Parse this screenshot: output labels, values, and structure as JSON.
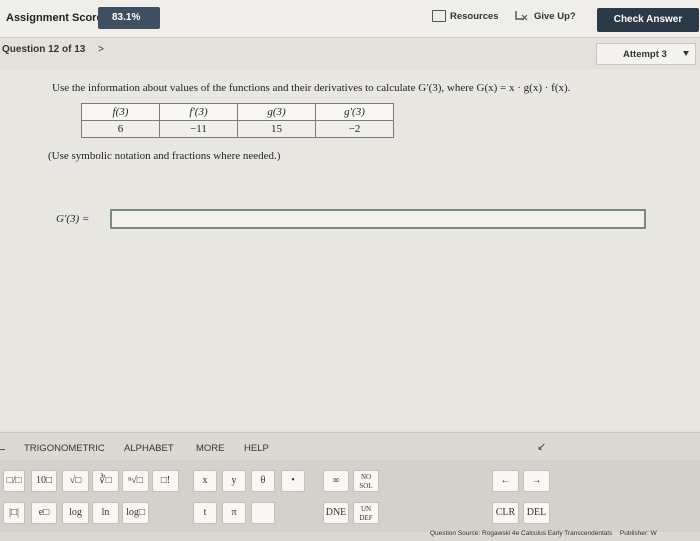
{
  "topbar": {
    "score_label": "Assignment Score:",
    "score_value": "83.1%",
    "resources_label": "Resources",
    "give_up_label": "Give Up?",
    "check_answer_label": "Check Answer"
  },
  "question": {
    "header": "Question 12 of 13",
    "next_glyph": ">",
    "attempt": "Attempt 3"
  },
  "content": {
    "instruction_text": "Use the information about values of the functions and their derivatives to calculate G′(3), where G(x) = x · g(x) · f(x).",
    "table": {
      "headers": [
        "f(3)",
        "f′(3)",
        "g(3)",
        "g′(3)"
      ],
      "values": [
        "6",
        "−11",
        "15",
        "−2"
      ]
    },
    "note": "(Use symbolic notation and fractions where needed.)",
    "answer_label": "G′(3) =",
    "answer_value": ""
  },
  "keypad": {
    "tabs": [
      "TRIGONOMETRIC",
      "ALPHABET",
      "MORE",
      "HELP"
    ],
    "collapse_glyph": "↙",
    "row1": [
      "□/□",
      "10□",
      "√□",
      "∛□",
      "ⁿ√□",
      "□!",
      "x",
      "y",
      "θ",
      "•",
      "∞",
      "NO SOL",
      "←",
      "→"
    ],
    "row2": [
      "|□|",
      "e□",
      "log",
      "ln",
      "log□",
      "t",
      "π",
      "",
      "DNE",
      "UN DEF",
      "CLR",
      "DEL"
    ]
  },
  "footer": {
    "source": "Question Source: Rogawski 4e Calculus Early Transcendentals",
    "publisher": "Publisher: W"
  }
}
